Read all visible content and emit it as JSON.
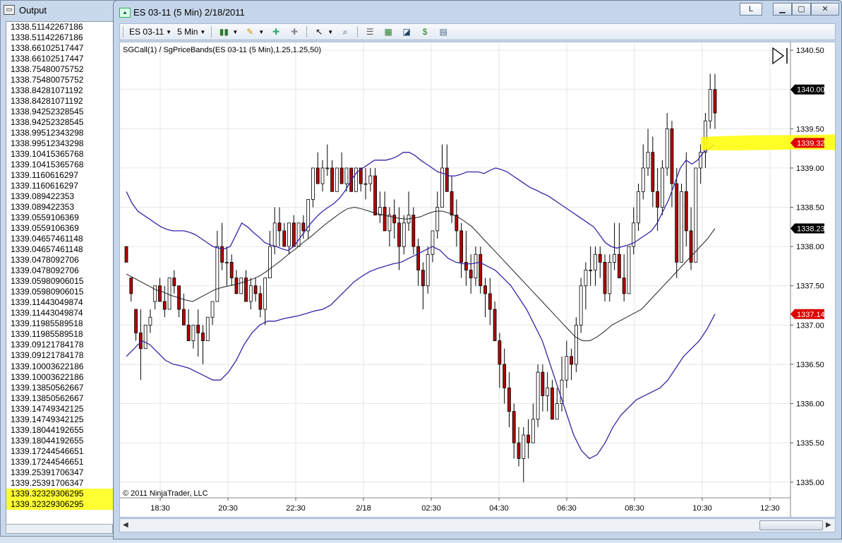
{
  "output": {
    "title": "Output",
    "lines": [
      "1338.51142267186",
      "1338.51142267186",
      "1338.66102517447",
      "1338.66102517447",
      "1338.75480075752",
      "1338.75480075752",
      "1338.84281071192",
      "1338.84281071192",
      "1338.94252328545",
      "1338.94252328545",
      "1338.99512343298",
      "1338.99512343298",
      "1339.10415365768",
      "1339.10415365768",
      "1339.1160616297",
      "1339.1160616297",
      "1339.089422353",
      "1339.089422353",
      "1339.0559106369",
      "1339.0559106369",
      "1339.04657461148",
      "1339.04657461148",
      "1339.0478092706",
      "1339.0478092706",
      "1339.05980906015",
      "1339.05980906015",
      "1339.11443049874",
      "1339.11443049874",
      "1339.11985589518",
      "1339.11985589518",
      "1339.09121784178",
      "1339.09121784178",
      "1339.10003622186",
      "1339.10003622186",
      "1339.13850562667",
      "1339.13850562667",
      "1339.14749342125",
      "1339.14749342125",
      "1339.18044192655",
      "1339.18044192655",
      "1339.17244546651",
      "1339.17244546651",
      "1339.25391706347",
      "1339.25391706347",
      "1339.32329306295",
      "1339.32329306295"
    ],
    "highlight_color": "#ffff33"
  },
  "chart_window": {
    "title": "ES 03-11 (5 Min)  2/18/2011",
    "link_button": "L",
    "toolbar": {
      "instrument": "ES 03-11",
      "interval": "5 Min"
    },
    "indicator_label": "SGCall(1) / SgPriceBands(ES 03-11 (5 Min),1.25,1.25,50)",
    "copyright": "© 2011 NinjaTrader, LLC"
  },
  "chart_data": {
    "type": "bar",
    "style": "OHLC bars (candlestick-like, up=white, down=red)",
    "x_ticks": [
      "18:30",
      "20:30",
      "22:30",
      "2/18",
      "02:30",
      "04:30",
      "06:30",
      "08:30",
      "10:30",
      "12:30"
    ],
    "y_ticks": [
      "1340.50",
      "1340.00",
      "1339.50",
      "1339.00",
      "1338.50",
      "1338.00",
      "1337.50",
      "1337.00",
      "1336.50",
      "1336.00",
      "1335.50",
      "1335.00"
    ],
    "y_range": [
      1334.8,
      1340.6
    ],
    "price_markers": [
      {
        "label": "1340.00",
        "value": 1340.0,
        "color": "#000000"
      },
      {
        "label": "1339.32",
        "value": 1339.32,
        "color": "#dd0000"
      },
      {
        "label": "1338.23",
        "value": 1338.23,
        "color": "#000000"
      },
      {
        "label": "1337.14",
        "value": 1337.14,
        "color": "#dd0000"
      }
    ],
    "ohlc": [
      [
        1338.0,
        1338.0,
        1337.8,
        1337.8
      ],
      [
        1337.6,
        1337.6,
        1337.3,
        1337.4
      ],
      [
        1337.2,
        1337.2,
        1336.8,
        1336.9
      ],
      [
        1336.9,
        1337.2,
        1336.3,
        1336.7
      ],
      [
        1336.7,
        1337.0,
        1336.7,
        1337.0
      ],
      [
        1337.0,
        1337.2,
        1336.9,
        1337.1
      ],
      [
        1337.3,
        1337.5,
        1337.2,
        1337.5
      ],
      [
        1337.5,
        1337.6,
        1337.3,
        1337.3
      ],
      [
        1337.3,
        1337.5,
        1337.1,
        1337.2
      ],
      [
        1337.2,
        1337.6,
        1337.2,
        1337.6
      ],
      [
        1337.6,
        1337.7,
        1337.4,
        1337.5
      ],
      [
        1337.5,
        1337.5,
        1337.1,
        1337.2
      ],
      [
        1337.2,
        1337.4,
        1337.0,
        1337.0
      ],
      [
        1337.0,
        1337.2,
        1336.8,
        1336.8
      ],
      [
        1336.8,
        1337.0,
        1336.7,
        1337.0
      ],
      [
        1337.0,
        1337.2,
        1336.6,
        1336.9
      ],
      [
        1336.9,
        1337.0,
        1336.5,
        1336.8
      ],
      [
        1336.8,
        1337.1,
        1336.8,
        1337.1
      ],
      [
        1337.1,
        1337.3,
        1337.0,
        1337.3
      ],
      [
        1337.3,
        1338.2,
        1337.3,
        1338.0
      ],
      [
        1338.0,
        1338.3,
        1337.7,
        1337.8
      ],
      [
        1337.8,
        1338.0,
        1337.5,
        1337.8
      ],
      [
        1337.8,
        1337.9,
        1337.5,
        1337.6
      ],
      [
        1337.6,
        1337.7,
        1337.4,
        1337.4
      ],
      [
        1337.4,
        1337.6,
        1337.4,
        1337.6
      ],
      [
        1337.6,
        1337.7,
        1337.3,
        1337.3
      ],
      [
        1337.3,
        1337.6,
        1337.2,
        1337.5
      ],
      [
        1337.5,
        1337.6,
        1337.3,
        1337.4
      ],
      [
        1337.4,
        1337.5,
        1337.1,
        1337.2
      ],
      [
        1337.2,
        1337.6,
        1337.0,
        1337.6
      ],
      [
        1337.6,
        1338.2,
        1337.6,
        1338.0
      ],
      [
        1338.0,
        1338.5,
        1337.9,
        1338.3
      ],
      [
        1338.3,
        1338.5,
        1338.0,
        1338.2
      ],
      [
        1338.2,
        1338.3,
        1338.0,
        1338.0
      ],
      [
        1338.0,
        1338.3,
        1337.9,
        1338.3
      ],
      [
        1338.3,
        1338.4,
        1338.0,
        1338.0
      ],
      [
        1338.0,
        1338.3,
        1338.0,
        1338.3
      ],
      [
        1338.3,
        1338.4,
        1338.1,
        1338.2
      ],
      [
        1338.2,
        1338.6,
        1338.1,
        1338.6
      ],
      [
        1338.6,
        1339.0,
        1338.5,
        1339.0
      ],
      [
        1339.0,
        1339.2,
        1338.8,
        1338.8
      ],
      [
        1338.8,
        1339.1,
        1338.7,
        1339.0
      ],
      [
        1339.0,
        1339.3,
        1338.9,
        1339.0
      ],
      [
        1339.0,
        1339.1,
        1338.7,
        1338.7
      ],
      [
        1338.7,
        1339.0,
        1338.7,
        1339.0
      ],
      [
        1339.0,
        1339.2,
        1338.8,
        1338.8
      ],
      [
        1338.8,
        1339.0,
        1338.7,
        1339.0
      ],
      [
        1339.0,
        1339.0,
        1338.7,
        1338.7
      ],
      [
        1338.7,
        1339.0,
        1338.7,
        1339.0
      ],
      [
        1339.0,
        1339.0,
        1338.7,
        1338.8
      ],
      [
        1338.8,
        1339.0,
        1338.6,
        1338.8
      ],
      [
        1338.8,
        1339.0,
        1338.7,
        1338.9
      ],
      [
        1338.9,
        1339.0,
        1338.4,
        1338.4
      ],
      [
        1338.4,
        1338.7,
        1338.3,
        1338.5
      ],
      [
        1338.5,
        1338.7,
        1338.2,
        1338.2
      ],
      [
        1338.2,
        1338.5,
        1338.0,
        1338.4
      ],
      [
        1338.4,
        1338.6,
        1338.1,
        1338.3
      ],
      [
        1338.3,
        1338.5,
        1337.7,
        1338.0
      ],
      [
        1338.0,
        1338.4,
        1337.9,
        1338.3
      ],
      [
        1338.3,
        1338.7,
        1338.2,
        1338.4
      ],
      [
        1338.4,
        1338.5,
        1337.9,
        1338.0
      ],
      [
        1338.0,
        1338.1,
        1337.5,
        1337.7
      ],
      [
        1337.7,
        1337.8,
        1337.2,
        1337.5
      ],
      [
        1337.5,
        1338.0,
        1337.4,
        1337.9
      ],
      [
        1337.9,
        1338.2,
        1337.8,
        1338.2
      ],
      [
        1338.2,
        1338.7,
        1338.1,
        1338.5
      ],
      [
        1338.5,
        1339.3,
        1338.5,
        1339.0
      ],
      [
        1339.0,
        1339.3,
        1338.7,
        1338.7
      ],
      [
        1338.7,
        1338.9,
        1338.3,
        1338.4
      ],
      [
        1338.4,
        1338.6,
        1338.0,
        1338.2
      ],
      [
        1338.2,
        1338.3,
        1337.6,
        1337.8
      ],
      [
        1337.8,
        1338.2,
        1337.5,
        1337.7
      ],
      [
        1337.7,
        1337.9,
        1337.4,
        1337.6
      ],
      [
        1337.6,
        1338.0,
        1337.5,
        1337.9
      ],
      [
        1337.9,
        1338.0,
        1337.4,
        1337.5
      ],
      [
        1337.5,
        1337.6,
        1337.1,
        1337.4
      ],
      [
        1337.4,
        1337.6,
        1337.0,
        1337.2
      ],
      [
        1337.2,
        1337.3,
        1336.8,
        1336.8
      ],
      [
        1336.8,
        1336.9,
        1336.2,
        1336.5
      ],
      [
        1336.5,
        1336.7,
        1336.0,
        1336.2
      ],
      [
        1336.2,
        1336.4,
        1335.7,
        1335.9
      ],
      [
        1335.9,
        1336.0,
        1335.3,
        1335.5
      ],
      [
        1335.5,
        1335.7,
        1335.2,
        1335.3
      ],
      [
        1335.3,
        1335.7,
        1335.0,
        1335.6
      ],
      [
        1335.6,
        1335.8,
        1335.3,
        1335.5
      ],
      [
        1335.5,
        1336.0,
        1335.5,
        1335.8
      ],
      [
        1335.8,
        1336.5,
        1335.7,
        1336.4
      ],
      [
        1336.4,
        1336.5,
        1335.9,
        1336.1
      ],
      [
        1336.1,
        1336.4,
        1335.9,
        1336.2
      ],
      [
        1336.2,
        1336.3,
        1335.8,
        1335.8
      ],
      [
        1335.8,
        1336.2,
        1335.8,
        1336.0
      ],
      [
        1336.0,
        1336.6,
        1335.9,
        1336.3
      ],
      [
        1336.3,
        1336.8,
        1336.2,
        1336.6
      ],
      [
        1336.6,
        1336.7,
        1336.3,
        1336.5
      ],
      [
        1336.5,
        1337.1,
        1336.4,
        1337.0
      ],
      [
        1337.0,
        1337.6,
        1336.9,
        1337.5
      ],
      [
        1337.5,
        1337.8,
        1337.2,
        1337.7
      ],
      [
        1337.7,
        1338.0,
        1337.5,
        1337.7
      ],
      [
        1337.7,
        1338.0,
        1337.5,
        1337.9
      ],
      [
        1337.9,
        1338.0,
        1337.6,
        1337.8
      ],
      [
        1337.8,
        1337.9,
        1337.3,
        1337.4
      ],
      [
        1337.4,
        1337.9,
        1337.3,
        1337.8
      ],
      [
        1337.8,
        1338.3,
        1337.7,
        1337.9
      ],
      [
        1337.9,
        1338.3,
        1337.6,
        1337.6
      ],
      [
        1337.6,
        1337.9,
        1337.3,
        1337.4
      ],
      [
        1337.4,
        1338.0,
        1337.4,
        1338.0
      ],
      [
        1338.0,
        1338.5,
        1337.9,
        1338.3
      ],
      [
        1338.3,
        1338.8,
        1338.2,
        1338.7
      ],
      [
        1338.7,
        1339.3,
        1338.6,
        1339.0
      ],
      [
        1339.0,
        1339.5,
        1338.9,
        1339.2
      ],
      [
        1339.2,
        1339.4,
        1338.5,
        1338.7
      ],
      [
        1338.7,
        1339.0,
        1338.2,
        1338.5
      ],
      [
        1338.5,
        1339.1,
        1338.4,
        1339.0
      ],
      [
        1339.0,
        1339.7,
        1338.9,
        1339.5
      ],
      [
        1339.5,
        1339.6,
        1338.5,
        1338.8
      ],
      [
        1338.8,
        1339.0,
        1337.6,
        1337.8
      ],
      [
        1337.8,
        1338.8,
        1337.8,
        1338.7
      ],
      [
        1338.7,
        1339.2,
        1338.0,
        1338.2
      ],
      [
        1338.2,
        1338.5,
        1337.7,
        1337.8
      ],
      [
        1337.8,
        1339.0,
        1337.8,
        1339.0
      ],
      [
        1339.0,
        1339.3,
        1338.8,
        1339.2
      ],
      [
        1339.2,
        1339.7,
        1339.0,
        1339.6
      ],
      [
        1339.6,
        1340.2,
        1339.5,
        1340.0
      ],
      [
        1340.0,
        1340.2,
        1339.5,
        1339.7
      ]
    ],
    "series": [
      {
        "name": "upper band",
        "color": "#3a22a8",
        "values": [
          1338.7,
          1338.55,
          1338.45,
          1338.4,
          1338.35,
          1338.3,
          1338.25,
          1338.22,
          1338.2,
          1338.2,
          1338.2,
          1338.18,
          1338.15,
          1338.1,
          1338.05,
          1338.0,
          1337.98,
          1337.97,
          1338.0,
          1338.15,
          1338.3,
          1338.25,
          1338.18,
          1338.12,
          1338.05,
          1338.02,
          1338.0,
          1337.97,
          1337.95,
          1338.0,
          1338.1,
          1338.2,
          1338.3,
          1338.38,
          1338.45,
          1338.5,
          1338.55,
          1338.62,
          1338.72,
          1338.85,
          1338.95,
          1339.0,
          1339.05,
          1339.1,
          1339.1,
          1339.1,
          1339.12,
          1339.15,
          1339.2,
          1339.2,
          1339.16,
          1339.1,
          1339.05,
          1339.0,
          1338.95,
          1338.93,
          1338.9,
          1338.9,
          1338.92,
          1338.95,
          1338.95,
          1338.95,
          1338.93,
          1338.97,
          1339.0,
          1338.98,
          1338.95,
          1338.9,
          1338.85,
          1338.8,
          1338.75,
          1338.72,
          1338.68,
          1338.65,
          1338.6,
          1338.55,
          1338.5,
          1338.45,
          1338.4,
          1338.35,
          1338.3,
          1338.25,
          1338.15,
          1338.05,
          1338.0,
          1337.98,
          1338.0,
          1338.02,
          1338.05,
          1338.1,
          1338.15,
          1338.2,
          1338.3,
          1338.45,
          1338.6,
          1338.8,
          1339.0,
          1339.1,
          1339.05,
          1339.1,
          1339.2,
          1339.25,
          1339.3
        ]
      },
      {
        "name": "middle",
        "color": "#222222",
        "values": [
          1337.65,
          1337.6,
          1337.55,
          1337.5,
          1337.45,
          1337.42,
          1337.38,
          1337.35,
          1337.32,
          1337.3,
          1337.35,
          1337.4,
          1337.45,
          1337.48,
          1337.5,
          1337.52,
          1337.55,
          1337.58,
          1337.62,
          1337.68,
          1337.75,
          1337.82,
          1337.9,
          1337.97,
          1338.05,
          1338.12,
          1338.2,
          1338.28,
          1338.35,
          1338.42,
          1338.48,
          1338.5,
          1338.48,
          1338.45,
          1338.42,
          1338.4,
          1338.38,
          1338.36,
          1338.35,
          1338.36,
          1338.38,
          1338.42,
          1338.45,
          1338.45,
          1338.42,
          1338.38,
          1338.32,
          1338.25,
          1338.15,
          1338.05,
          1337.95,
          1337.85,
          1337.75,
          1337.65,
          1337.55,
          1337.45,
          1337.35,
          1337.25,
          1337.15,
          1337.05,
          1336.95,
          1336.85,
          1336.8,
          1336.8,
          1336.85,
          1336.92,
          1337.0,
          1337.05,
          1337.1,
          1337.15,
          1337.2,
          1337.3,
          1337.4,
          1337.5,
          1337.6,
          1337.7,
          1337.8,
          1337.9,
          1338.0,
          1338.1,
          1338.23
        ]
      },
      {
        "name": "lower band",
        "color": "#3a22a8",
        "values": [
          1336.6,
          1336.7,
          1336.8,
          1336.75,
          1336.65,
          1336.55,
          1336.5,
          1336.48,
          1336.45,
          1336.4,
          1336.35,
          1336.3,
          1336.3,
          1336.4,
          1336.55,
          1336.75,
          1336.9,
          1337.0,
          1337.05,
          1337.05,
          1337.08,
          1337.1,
          1337.12,
          1337.15,
          1337.18,
          1337.2,
          1337.25,
          1337.35,
          1337.45,
          1337.55,
          1337.62,
          1337.68,
          1337.72,
          1337.75,
          1337.78,
          1337.8,
          1337.85,
          1337.9,
          1337.95,
          1338.0,
          1337.95,
          1337.85,
          1337.8,
          1337.78,
          1337.78,
          1337.8,
          1337.75,
          1337.7,
          1337.6,
          1337.5,
          1337.35,
          1337.2,
          1337.0,
          1336.8,
          1336.5,
          1336.2,
          1335.9,
          1335.6,
          1335.4,
          1335.3,
          1335.35,
          1335.5,
          1335.7,
          1335.85,
          1335.95,
          1336.05,
          1336.1,
          1336.15,
          1336.2,
          1336.3,
          1336.45,
          1336.6,
          1336.7,
          1336.8,
          1336.95,
          1337.14
        ]
      }
    ],
    "grid": true,
    "annotation_highlight": "yellow marker at 1339.32"
  }
}
